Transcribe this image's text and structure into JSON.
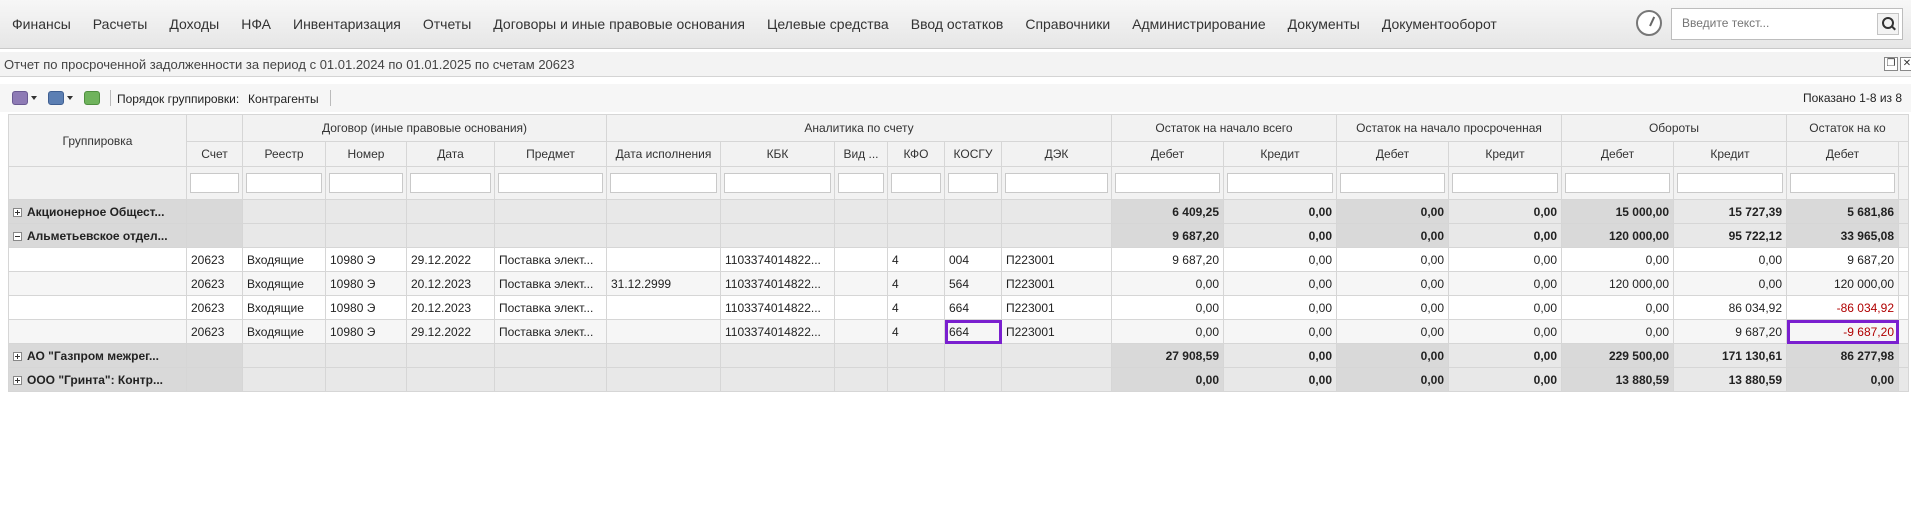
{
  "nav": {
    "items": [
      "Финансы",
      "Расчеты",
      "Доходы",
      "НФА",
      "Инвентаризация",
      "Отчеты",
      "Договоры и иные правовые основания",
      "Целевые средства",
      "Ввод остатков",
      "Справочники",
      "Администрирование",
      "Документы",
      "Документооборот"
    ],
    "search_placeholder": "Введите текст..."
  },
  "report": {
    "title": "Отчет по просроченной задолженности за период с 01.01.2024 по 01.01.2025 по счетам 20623"
  },
  "toolbar": {
    "grouping_label": "Порядок группировки:",
    "grouping_value": "Контрагенты",
    "shown_text": "Показано 1-8 из 8"
  },
  "grid": {
    "top_headers": {
      "grouping": "Группировка",
      "contract": "Договор (иные правовые основания)",
      "analytics": "Аналитика по счету",
      "open_total": "Остаток на начало всего",
      "open_overdue": "Остаток на начало просроченная",
      "turnover": "Обороты",
      "close": "Остаток на ко"
    },
    "sub_headers": {
      "account": "Счет",
      "registry": "Реестр",
      "number": "Номер",
      "date": "Дата",
      "subject": "Предмет",
      "exec_date": "Дата исполнения",
      "kbk": "КБК",
      "vid": "Вид ...",
      "kfo": "КФО",
      "kosgu": "КОСГУ",
      "dek": "ДЭК",
      "debit": "Дебет",
      "credit": "Кредит"
    },
    "rows": [
      {
        "kind": "group",
        "expander": "plus",
        "name": "Акционерное Общест...",
        "ot_d": "6 409,25",
        "ot_c": "0,00",
        "oo_d": "0,00",
        "oo_c": "0,00",
        "to_d": "15 000,00",
        "to_c": "15 727,39",
        "cl_d": "5 681,86"
      },
      {
        "kind": "group",
        "expander": "minus",
        "name": "Альметьевское отдел...",
        "ot_d": "9 687,20",
        "ot_c": "0,00",
        "oo_d": "0,00",
        "oo_c": "0,00",
        "to_d": "120 000,00",
        "to_c": "95 722,12",
        "cl_d": "33 965,08"
      },
      {
        "kind": "detail",
        "account": "20623",
        "registry": "Входящие",
        "number": "10980 Э",
        "date": "29.12.2022",
        "subject": "Поставка элект...",
        "exec_date": "",
        "kbk": "1103374014822...",
        "vid": "",
        "kfo": "4",
        "kosgu": "004",
        "dek": "П223001",
        "ot_d": "9 687,20",
        "ot_c": "0,00",
        "oo_d": "0,00",
        "oo_c": "0,00",
        "to_d": "0,00",
        "to_c": "0,00",
        "cl_d": "9 687,20"
      },
      {
        "kind": "detail",
        "account": "20623",
        "registry": "Входящие",
        "number": "10980 Э",
        "date": "20.12.2023",
        "subject": "Поставка элект...",
        "exec_date": "31.12.2999",
        "kbk": "1103374014822...",
        "vid": "",
        "kfo": "4",
        "kosgu": "564",
        "dek": "П223001",
        "ot_d": "0,00",
        "ot_c": "0,00",
        "oo_d": "0,00",
        "oo_c": "0,00",
        "to_d": "120 000,00",
        "to_c": "0,00",
        "cl_d": "120 000,00"
      },
      {
        "kind": "detail",
        "account": "20623",
        "registry": "Входящие",
        "number": "10980 Э",
        "date": "20.12.2023",
        "subject": "Поставка элект...",
        "exec_date": "",
        "kbk": "1103374014822...",
        "vid": "",
        "kfo": "4",
        "kosgu": "664",
        "dek": "П223001",
        "ot_d": "0,00",
        "ot_c": "0,00",
        "oo_d": "0,00",
        "oo_c": "0,00",
        "to_d": "0,00",
        "to_c": "86 034,92",
        "cl_d": "-86 034,92"
      },
      {
        "kind": "detail",
        "account": "20623",
        "registry": "Входящие",
        "number": "10980 Э",
        "date": "29.12.2022",
        "subject": "Поставка элект...",
        "exec_date": "",
        "kbk": "1103374014822...",
        "vid": "",
        "kfo": "4",
        "kosgu": "664",
        "dek": "П223001",
        "ot_d": "0,00",
        "ot_c": "0,00",
        "oo_d": "0,00",
        "oo_c": "0,00",
        "to_d": "0,00",
        "to_c": "9 687,20",
        "cl_d": "-9 687,20"
      },
      {
        "kind": "group",
        "expander": "plus",
        "name": "АО \"Газпром межрег...",
        "ot_d": "27 908,59",
        "ot_c": "0,00",
        "oo_d": "0,00",
        "oo_c": "0,00",
        "to_d": "229 500,00",
        "to_c": "171 130,61",
        "cl_d": "86 277,98"
      },
      {
        "kind": "group",
        "expander": "plus",
        "name": "ООО \"Гринта\": Контр...",
        "ot_d": "0,00",
        "ot_c": "0,00",
        "oo_d": "0,00",
        "oo_c": "0,00",
        "to_d": "13 880,59",
        "to_c": "13 880,59",
        "cl_d": "0,00"
      }
    ]
  },
  "colors": {
    "highlight": "#7a1fcf",
    "negative": "#b00000"
  }
}
